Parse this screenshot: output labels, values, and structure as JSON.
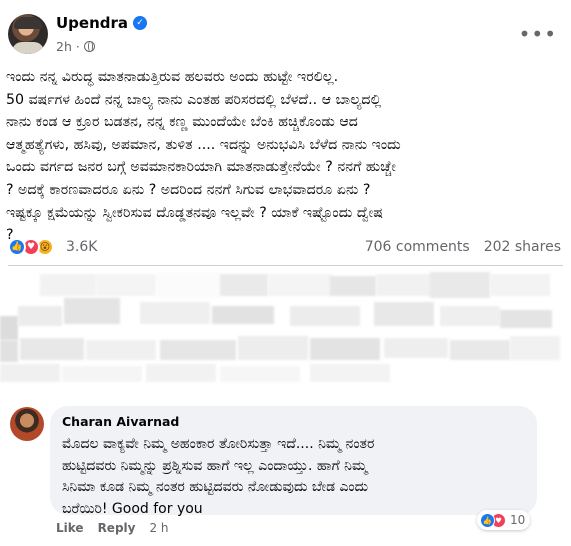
{
  "post": {
    "author": "Upendra",
    "time": "2h",
    "icons": {
      "verified": "verified-badge-icon",
      "audience": "globe-icon",
      "more": "more-options-icon"
    },
    "lines": [
      "ಇಂದು ನನ್ನ ವಿರುದ್ಧ ಮಾತನಾಡುತ್ತಿರುವ ಹಲವರು ಅಂದು ಹುಟ್ಟೇ ಇರಲಿಲ್ಲ.",
      "50 ವರ್ಷಗಳ ಹಿಂದೆ ನನ್ನ ಬಾಲ್ಯ ನಾನು ಎಂತಹ ಪರಿಸರದಲ್ಲಿ ಬೆಳದೆ.. ಆ ಬಾಲ್ಯದಲ್ಲಿ",
      "ನಾನು ಕಂಡ ಆ ಕ್ರೂರ ಬಡತನ, ನನ್ನ ಕಣ್ಣ ಮುಂದೆಯೇ ಬೆಂಕಿ ಹಚ್ಚಿಕೊಂಡು ಆದ",
      "ಆತ್ಮಹತ್ಯೆಗಳು, ಹಸಿವು, ಅಪಮಾನ, ತುಳಿತ .... ಇದನ್ನು ಅನುಭವಿಸಿ ಬೆಳೆದ ನಾನು ಇಂದು",
      "ಒಂದು ವರ್ಗದ ಜನರ ಬಗ್ಗೆ ಅವಮಾನಕಾರಿಯಾಗಿ ಮಾತನಾಡುತ್ತೇನೆಯೇ ? ನನಗೆ ಹುಚ್ಚೇ",
      "? ಅದಕ್ಕೆ ಕಾರಣವಾದರೂ ಏನು ? ಅದರಿಂದ ನನಗೆ ಸಿಗುವ ಲಾಭವಾದರೂ ಏನು ?",
      "ಇಷ್ಟಕ್ಕೂ ಕ್ಷಮೆಯನ್ನು ಸ್ವೀಕರಿಸುವ ದೊಡ್ಡತನವೂ ಇಲ್ಲವೇ ? ಯಾಕೆ ಇಷ್ಟೊಂದು ದ್ವೇಷ",
      "?"
    ],
    "reaction_count": "3.6K",
    "reaction_icons": [
      "like-reaction-icon",
      "love-reaction-icon",
      "wow-reaction-icon"
    ],
    "comments_count": "706 comments",
    "shares_count": "202 shares"
  },
  "comment": {
    "author": "Charan Aivarnad",
    "lines": [
      "ಮೊದಲ ವಾಕ್ಯವೇ ನಿಮ್ಮ ಅಹಂಕಾರ ತೋರಿಸುತ್ತಾ ಇದೆ.... ನಿಮ್ಮ ನಂತರ",
      "ಹುಟ್ಟಿದವರು ನಿಮ್ಮನ್ನು ಪ್ರಶ್ನಿಸುವ ಹಾಗೆ ಇಲ್ಲ ಎಂದಾಯ್ತು. ಹಾಗೆ ನಿಮ್ಮ",
      "ಸಿನಿಮಾ ಕೂಡ ನಿಮ್ಮ ನಂತರ ಹುಟ್ಟಿದವರು ನೋಡುವುದು ಬೇಡ ಎಂದು",
      "ಬರೆಯಿರಿ! Good for you"
    ],
    "like_label": "Like",
    "reply_label": "Reply",
    "time": "2 h",
    "reaction_count": "10",
    "reaction_icons": [
      "like-reaction-icon",
      "love-reaction-icon"
    ]
  },
  "colors": {
    "facebook_blue": "#1877f2",
    "love_red": "#f33e58",
    "wow_yellow": "#f7b125",
    "secondary_text": "#65676b",
    "bubble_bg": "#f0f2f5"
  }
}
